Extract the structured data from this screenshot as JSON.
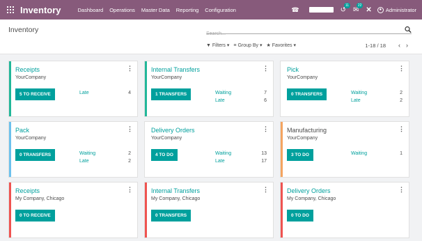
{
  "navbar": {
    "brand": "Inventory",
    "menu": [
      "Dashboard",
      "Operations",
      "Master Data",
      "Reporting",
      "Configuration"
    ],
    "activity_badge": "11",
    "messages_badge": "22",
    "user_name": "Administrator"
  },
  "control_panel": {
    "breadcrumb": "Inventory",
    "search_placeholder": "Search...",
    "filters_label": "Filters",
    "groupby_label": "Group By",
    "favorites_label": "Favorites",
    "pager": "1-18 / 18"
  },
  "colors": {
    "navbar": "#875a7b",
    "accent": "#00a09d"
  },
  "cards": [
    {
      "title": "Receipts",
      "company": "YourCompany",
      "button": "5 TO RECEIVE",
      "color": "#21b799",
      "stats": [
        {
          "label": "Late",
          "count": "4"
        }
      ]
    },
    {
      "title": "Internal Transfers",
      "company": "YourCompany",
      "button": "1 TRANSFERS",
      "color": "#21b799",
      "stats": [
        {
          "label": "Waiting",
          "count": "7"
        },
        {
          "label": "Late",
          "count": "6"
        }
      ]
    },
    {
      "title": "Pick",
      "company": "YourCompany",
      "button": "0 TRANSFERS",
      "color": "",
      "stats": [
        {
          "label": "Waiting",
          "count": "2"
        },
        {
          "label": "Late",
          "count": "2"
        }
      ]
    },
    {
      "title": "Pack",
      "company": "YourCompany",
      "button": "0 TRANSFERS",
      "color": "#6cc1ed",
      "stats": [
        {
          "label": "Waiting",
          "count": "2"
        },
        {
          "label": "Late",
          "count": "2"
        }
      ]
    },
    {
      "title": "Delivery Orders",
      "company": "YourCompany",
      "button": "4 TO DO",
      "color": "",
      "stats": [
        {
          "label": "Waiting",
          "count": "13"
        },
        {
          "label": "Late",
          "count": "17"
        }
      ]
    },
    {
      "title": "Manufacturing",
      "company": "YourCompany",
      "button": "3 TO DO",
      "color": "#f4a460",
      "stats": [
        {
          "label": "Waiting",
          "count": "1"
        }
      ]
    },
    {
      "title": "Receipts",
      "company": "My Company, Chicago",
      "button": "0 TO RECEIVE",
      "color": "#ef5350",
      "stats": []
    },
    {
      "title": "Internal Transfers",
      "company": "My Company, Chicago",
      "button": "0 TRANSFERS",
      "color": "#ef5350",
      "stats": []
    },
    {
      "title": "Delivery Orders",
      "company": "My Company, Chicago",
      "button": "0 TO DO",
      "color": "#ef5350",
      "stats": []
    }
  ]
}
